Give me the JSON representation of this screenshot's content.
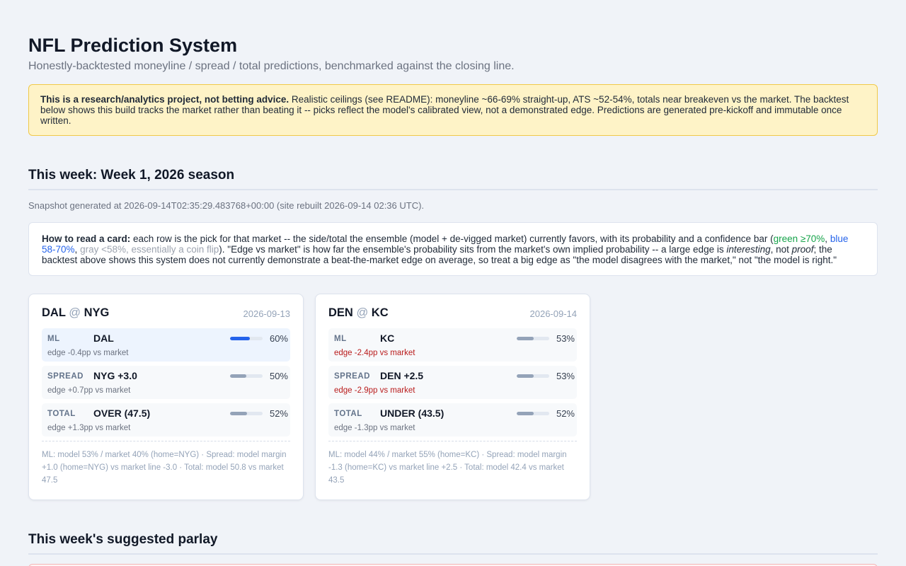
{
  "header": {
    "title": "NFL Prediction System",
    "subtitle": "Honestly-backtested moneyline / spread / total predictions, benchmarked against the closing line."
  },
  "disclaimer": {
    "bold": "This is a research/analytics project, not betting advice.",
    "text": " Realistic ceilings (see README): moneyline ~66-69% straight-up, ATS ~52-54%, totals near breakeven vs the market. The backtest below shows this build tracks the market rather than beating it -- picks reflect the model's calibrated view, not a demonstrated edge. Predictions are generated pre-kickoff and immutable once written."
  },
  "week_section": {
    "heading": "This week: Week 1, 2026 season",
    "snapshot": "Snapshot generated at 2026-09-14T02:35:29.483768+00:00 (site rebuilt 2026-09-14 02:36 UTC)."
  },
  "howto": {
    "bold": "How to read a card:",
    "part1": " each row is the pick for that market -- the side/total the ensemble (model + de-vigged market) currently favors, with its probability and a confidence bar (",
    "green": "green ≥70%",
    "sep1": ", ",
    "blue": "blue 58-70%",
    "sep2": ", ",
    "gray": "gray <58%, essentially a coin flip",
    "part2": "). \"Edge vs market\" is how far the ensemble's probability sits from the market's own implied probability -- a large edge is ",
    "interesting": "interesting",
    "part3": ", not ",
    "proof": "proof",
    "part4": "; the backtest above shows this system does not currently demonstrate a beat-the-market edge on average, so treat a big edge as \"the model disagrees with the market,\" not \"the model is right.\""
  },
  "games": [
    {
      "away": "DAL",
      "at": "@",
      "home": "NYG",
      "date": "2026-09-13",
      "rows": [
        {
          "label": "ML",
          "pick": "DAL",
          "prob": 0.6,
          "prob_text": "60%",
          "edge": "edge -0.4pp vs market",
          "edge_negative": false,
          "tier": "blue"
        },
        {
          "label": "SPREAD",
          "pick": "NYG +3.0",
          "prob": 0.5,
          "prob_text": "50%",
          "edge": "edge +0.7pp vs market",
          "edge_negative": false,
          "tier": "gray"
        },
        {
          "label": "TOTAL",
          "pick": "OVER (47.5)",
          "prob": 0.52,
          "prob_text": "52%",
          "edge": "edge +1.3pp vs market",
          "edge_negative": false,
          "tier": "gray"
        }
      ],
      "note": "ML: model 53% / market 40% (home=NYG) · Spread: model margin +1.0 (home=NYG) vs market line -3.0 · Total: model 50.8 vs market 47.5"
    },
    {
      "away": "DEN",
      "at": "@",
      "home": "KC",
      "date": "2026-09-14",
      "rows": [
        {
          "label": "ML",
          "pick": "KC",
          "prob": 0.53,
          "prob_text": "53%",
          "edge": "edge -2.4pp vs market",
          "edge_negative": true,
          "tier": "gray"
        },
        {
          "label": "SPREAD",
          "pick": "DEN +2.5",
          "prob": 0.53,
          "prob_text": "53%",
          "edge": "edge -2.9pp vs market",
          "edge_negative": true,
          "tier": "gray"
        },
        {
          "label": "TOTAL",
          "pick": "UNDER (43.5)",
          "prob": 0.52,
          "prob_text": "52%",
          "edge": "edge -1.3pp vs market",
          "edge_negative": false,
          "tier": "gray"
        }
      ],
      "note": "ML: model 44% / market 55% (home=KC) · Spread: model margin -1.3 (home=KC) vs market line +2.5 · Total: model 42.4 vs market 43.5"
    }
  ],
  "parlay_section": {
    "heading": "This week's suggested parlay"
  },
  "colors": {
    "bar_blue": "#2563eb",
    "bar_gray": "#94a3b8",
    "edge_negative": "#b91c1c",
    "disclaimer_bg": "#fef3c7"
  }
}
